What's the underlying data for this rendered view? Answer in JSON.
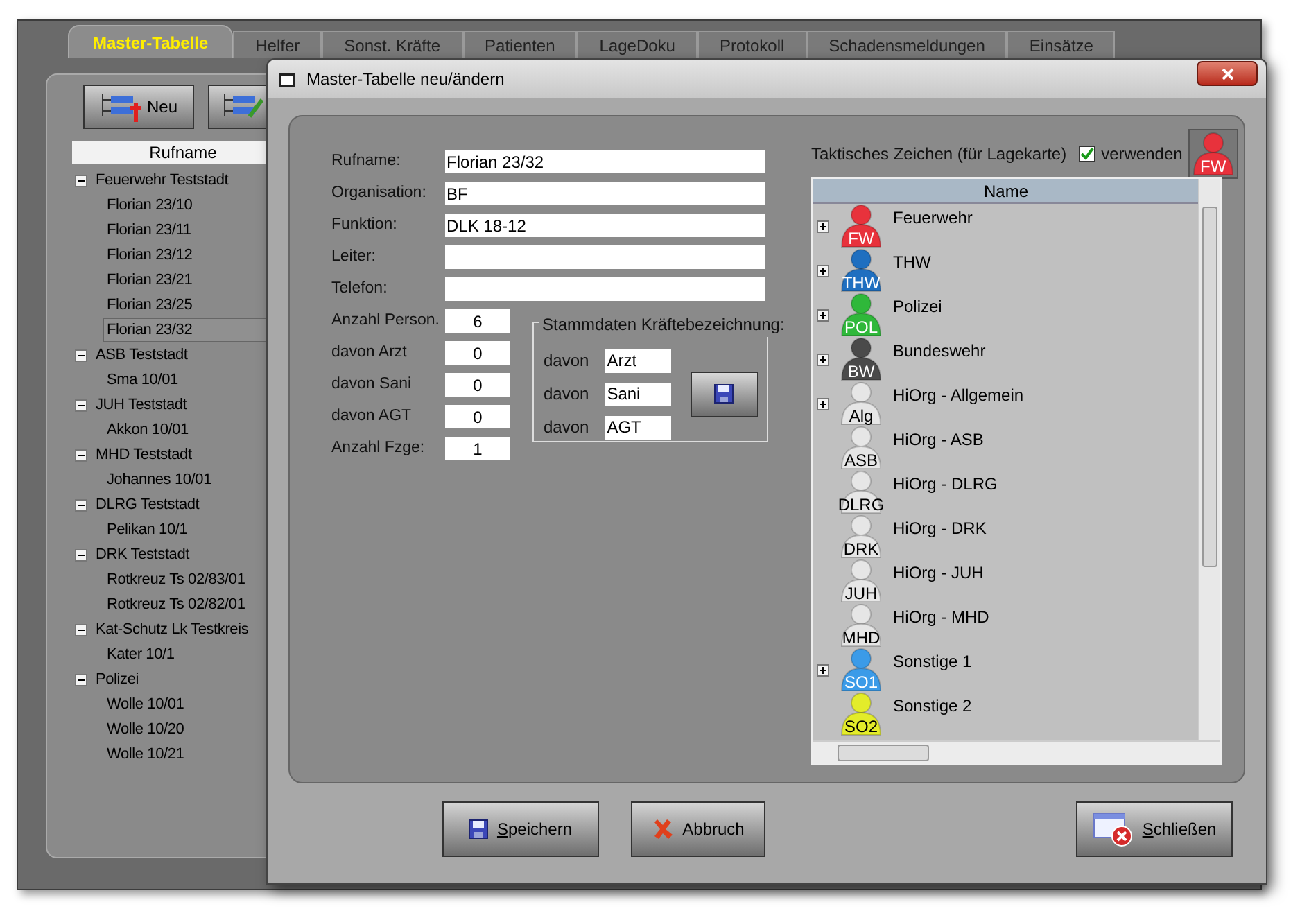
{
  "app": {
    "tabs": [
      {
        "label": "Master-Tabelle",
        "selected": true
      },
      {
        "label": "Helfer",
        "selected": false
      },
      {
        "label": "Sonst. Kräfte",
        "selected": false
      },
      {
        "label": "Patienten",
        "selected": false
      },
      {
        "label": "LageDoku",
        "selected": false
      },
      {
        "label": "Protokoll",
        "selected": false
      },
      {
        "label": "Schadensmeldungen",
        "selected": false
      },
      {
        "label": "Einsätze",
        "selected": false
      }
    ],
    "toolbar": {
      "new_button": "Neu"
    },
    "tree": {
      "header": "Rufname",
      "groups": [
        {
          "label": "Feuerwehr Teststadt",
          "expanded": true,
          "children": [
            {
              "label": "Florian 23/10",
              "selected": false
            },
            {
              "label": "Florian 23/11",
              "selected": false
            },
            {
              "label": "Florian 23/12",
              "selected": false
            },
            {
              "label": "Florian 23/21",
              "selected": false
            },
            {
              "label": "Florian 23/25",
              "selected": false
            },
            {
              "label": "Florian 23/32",
              "selected": true
            }
          ]
        },
        {
          "label": "ASB Teststadt",
          "expanded": true,
          "children": [
            {
              "label": "Sma 10/01",
              "selected": false
            }
          ]
        },
        {
          "label": "JUH Teststadt",
          "expanded": true,
          "children": [
            {
              "label": "Akkon 10/01",
              "selected": false
            }
          ]
        },
        {
          "label": "MHD Teststadt",
          "expanded": true,
          "children": [
            {
              "label": "Johannes 10/01",
              "selected": false
            }
          ]
        },
        {
          "label": "DLRG Teststadt",
          "expanded": true,
          "children": [
            {
              "label": "Pelikan 10/1",
              "selected": false
            }
          ]
        },
        {
          "label": "DRK Teststadt",
          "expanded": true,
          "children": [
            {
              "label": "Rotkreuz Ts 02/83/01",
              "selected": false
            },
            {
              "label": "Rotkreuz Ts 02/82/01",
              "selected": false
            }
          ]
        },
        {
          "label": "Kat-Schutz Lk Testkreis",
          "expanded": true,
          "children": [
            {
              "label": "Kater 10/1",
              "selected": false
            }
          ]
        },
        {
          "label": "Polizei",
          "expanded": true,
          "children": [
            {
              "label": "Wolle 10/01",
              "selected": false
            },
            {
              "label": "Wolle 10/20",
              "selected": false
            },
            {
              "label": "Wolle 10/21",
              "selected": false
            }
          ]
        }
      ]
    }
  },
  "dialog": {
    "title": "Master-Tabelle neu/ändern",
    "fields": [
      {
        "label": "Rufname:",
        "value": "Florian 23/32"
      },
      {
        "label": "Organisation:",
        "value": "BF"
      },
      {
        "label": "Funktion:",
        "value": "DLK 18-12"
      },
      {
        "label": "Leiter:"
      },
      {
        "label": "Telefon:"
      }
    ],
    "counts": [
      {
        "label": "Anzahl Person.",
        "value": "6"
      },
      {
        "label": "davon Arzt",
        "value": "0"
      },
      {
        "label": "davon Sani",
        "value": "0"
      },
      {
        "label": "davon AGT",
        "value": "0"
      },
      {
        "label": "Anzahl Fzge:",
        "value": "1"
      }
    ],
    "stammdaten": {
      "title": "Stammdaten Kräftebezeichnung:",
      "rows": [
        {
          "label": "davon",
          "value": "Arzt"
        },
        {
          "label": "davon",
          "value": "Sani"
        },
        {
          "label": "davon",
          "value": "AGT"
        }
      ]
    },
    "symbol": {
      "title": "Taktisches Zeichen (für Lagekarte)",
      "use_label": "verwenden",
      "use_checked": true,
      "preview": {
        "badge": "FW",
        "color": "#e8323c"
      },
      "list_header": "Name",
      "items": [
        {
          "badge": "FW",
          "label": "Feuerwehr",
          "color": "#e8323c",
          "expandable": true
        },
        {
          "badge": "THW",
          "label": "THW",
          "color": "#1f6fc0",
          "expandable": true
        },
        {
          "badge": "POL",
          "label": "Polizei",
          "color": "#2fb83a",
          "expandable": true
        },
        {
          "badge": "BW",
          "label": "Bundeswehr",
          "color": "#4a4a4a",
          "expandable": true
        },
        {
          "badge": "Alg",
          "label": "HiOrg - Allgemein",
          "color": "#e6e6e6",
          "expandable": true
        },
        {
          "badge": "ASB",
          "label": "HiOrg - ASB",
          "color": "#e6e6e6",
          "expandable": false
        },
        {
          "badge": "DLRG",
          "label": "HiOrg - DLRG",
          "color": "#e6e6e6",
          "expandable": false
        },
        {
          "badge": "DRK",
          "label": "HiOrg - DRK",
          "color": "#e6e6e6",
          "expandable": false
        },
        {
          "badge": "JUH",
          "label": "HiOrg - JUH",
          "color": "#e6e6e6",
          "expandable": false
        },
        {
          "badge": "MHD",
          "label": "HiOrg - MHD",
          "color": "#e6e6e6",
          "expandable": false
        },
        {
          "badge": "SO1",
          "label": "Sonstige 1",
          "color": "#3b9be8",
          "expandable": true
        },
        {
          "badge": "SO2",
          "label": "Sonstige 2",
          "color": "#e3ec2a",
          "expandable": false
        }
      ]
    },
    "buttons": [
      {
        "kind": "save",
        "label": "Speichern",
        "mnemonic": true
      },
      {
        "kind": "cancel",
        "label": "Abbruch",
        "mnemonic": false
      },
      {
        "kind": "close",
        "label": "Schließen",
        "mnemonic": true
      }
    ]
  }
}
